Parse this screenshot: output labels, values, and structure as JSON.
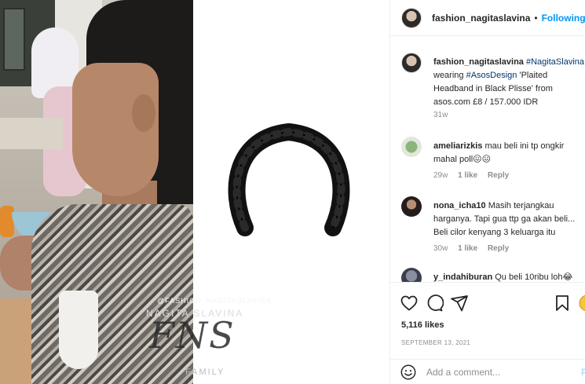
{
  "watermark": {
    "line1": "@FASHION_NAGITASLAVINA",
    "line2": "NAGITA SLAVINA",
    "logo": "FNS",
    "line3": "FAMILY"
  },
  "header": {
    "username": "fashion_nagitaslavina",
    "separator": "•",
    "follow_label": "Following"
  },
  "caption": {
    "username": "fashion_nagitaslavina",
    "mention": "#NagitaSlavina",
    "text_1": "wearing",
    "tag": "#AsosDesign",
    "text_2": "'Plaited Headband in Black Plisse' from asos.com £8 / 157.000 IDR",
    "time": "31w"
  },
  "comments": [
    {
      "username": "ameliarizkis",
      "text": "mau beli ini tp ongkir mahal poll😖😖",
      "time": "29w",
      "likes": "1 like",
      "reply": "Reply"
    },
    {
      "username": "nona_icha10",
      "text": "Masih terjangkau harganya. Tapi gua ttp ga akan beli... Beli cilor kenyang 3 keluarga itu",
      "time": "30w",
      "likes": "1 like",
      "reply": "Reply"
    },
    {
      "username": "y_indahiburan",
      "text": "Qu beli 10ribu loh😂"
    }
  ],
  "likes_label": "5,116 likes",
  "date_label": "SEPTEMBER 13, 2021",
  "comment_input": {
    "placeholder": "Add a comment...",
    "post_label": "P"
  },
  "icons": [
    "heart-icon",
    "comment-icon",
    "share-icon",
    "bookmark-icon",
    "emoji-icon"
  ],
  "colors": {
    "link_blue": "#0095f6",
    "tag_blue": "#00376b",
    "muted": "#8e8e8e"
  }
}
